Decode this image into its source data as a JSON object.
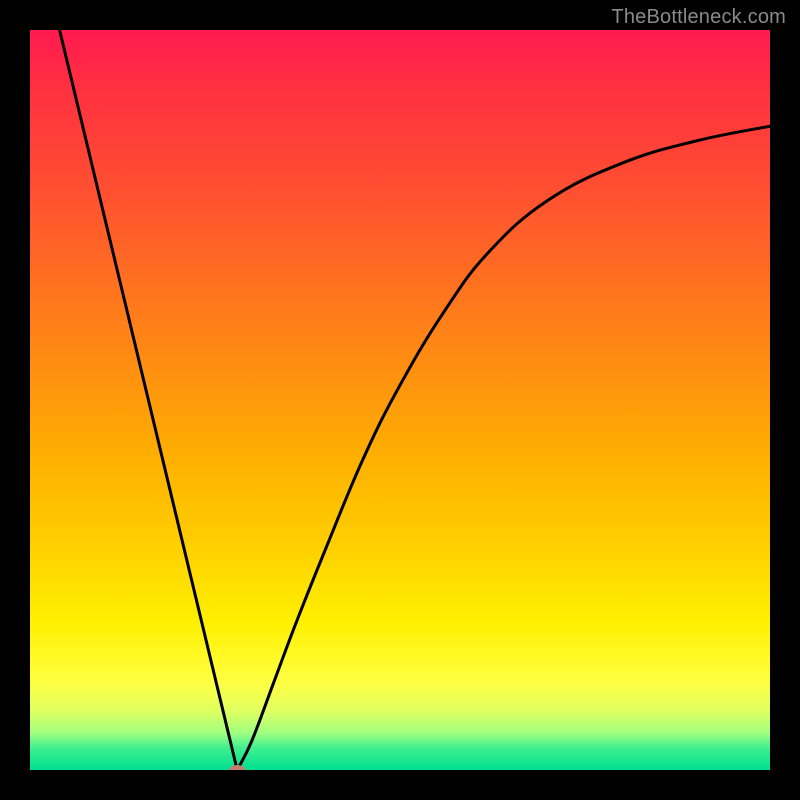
{
  "attribution": "TheBottleneck.com",
  "chart_data": {
    "type": "line",
    "xlim": [
      0,
      100
    ],
    "ylim": [
      0,
      100
    ],
    "title": "",
    "xlabel": "",
    "ylabel": "",
    "marker": {
      "x": 28,
      "y": 0,
      "color": "#c57e6c"
    },
    "series": [
      {
        "name": "curve",
        "points": [
          {
            "x": 4,
            "y": 100
          },
          {
            "x": 28,
            "y": 0
          },
          {
            "x": 30,
            "y": 4
          },
          {
            "x": 33,
            "y": 12
          },
          {
            "x": 36,
            "y": 20
          },
          {
            "x": 40,
            "y": 30
          },
          {
            "x": 45,
            "y": 42
          },
          {
            "x": 50,
            "y": 52
          },
          {
            "x": 56,
            "y": 62
          },
          {
            "x": 62,
            "y": 70
          },
          {
            "x": 70,
            "y": 77
          },
          {
            "x": 80,
            "y": 82
          },
          {
            "x": 90,
            "y": 85
          },
          {
            "x": 100,
            "y": 87
          }
        ]
      }
    ]
  }
}
